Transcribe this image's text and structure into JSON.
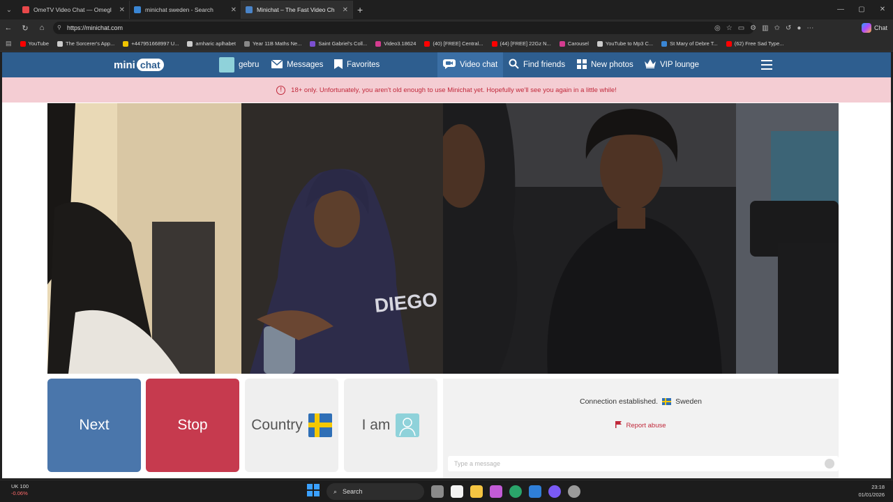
{
  "browser": {
    "tabs": [
      {
        "title": "OmeTV Video Chat — Omegl",
        "active": false,
        "color": "#e8484a"
      },
      {
        "title": "minichat sweden - Search",
        "active": false,
        "color": "#3a86d4"
      },
      {
        "title": "Minichat – The Fast Video Ch",
        "active": true,
        "color": "#4a84c8"
      }
    ],
    "new_tab": "+",
    "url": "https://minichat.com",
    "copilot_label": "Chat",
    "bookmarks": [
      {
        "label": "YouTube",
        "color": "#ff0000"
      },
      {
        "label": "The Sorcerer's App...",
        "color": "#cccccc"
      },
      {
        "label": "+447951668997 U...",
        "color": "#f0c400"
      },
      {
        "label": "amharic aplhabet",
        "color": "#cccccc"
      },
      {
        "label": "Year 11B Maths Ne...",
        "color": "#888888"
      },
      {
        "label": "Saint Gabriel's Coll...",
        "color": "#7b4fd0"
      },
      {
        "label": "Video3.18624",
        "color": "#d43c8f"
      },
      {
        "label": "(40) [FREE] Central...",
        "color": "#ff0000"
      },
      {
        "label": "(44) [FREE] 22Gz N...",
        "color": "#ff0000"
      },
      {
        "label": "Carousel",
        "color": "#d43c8f"
      },
      {
        "label": "YouTube to Mp3 C...",
        "color": "#cccccc"
      },
      {
        "label": "St Mary of Debre T...",
        "color": "#3a86d4"
      },
      {
        "label": "(62) Free Sad Type...",
        "color": "#ff0000"
      }
    ]
  },
  "site": {
    "logo_left": "mini",
    "logo_right": "chat",
    "nav": {
      "user": "gebru",
      "messages": "Messages",
      "favorites": "Favorites",
      "video_chat": "Video chat",
      "find_friends": "Find friends",
      "new_photos": "New photos",
      "vip_lounge": "VIP lounge"
    },
    "warning": "18+ only. Unfortunately, you aren't old enough to use Minichat yet. Hopefully we'll see you again in a little while!",
    "controls": {
      "next": "Next",
      "stop": "Stop",
      "country": "Country",
      "iam": "I am"
    },
    "chat": {
      "status": "Connection established.",
      "country": "Sweden",
      "report": "Report abuse",
      "placeholder": "Type a message"
    },
    "colors": {
      "nav": "#2e5e8f",
      "next": "#4a76ab",
      "stop": "#c63a4e",
      "warning_bg": "#f4cdd3",
      "warning_text": "#c0283a"
    }
  },
  "taskbar": {
    "stock_name": "UK 100",
    "stock_change": "-0.06%",
    "search": "Search",
    "time": "23:18",
    "date": "01/01/2026"
  }
}
